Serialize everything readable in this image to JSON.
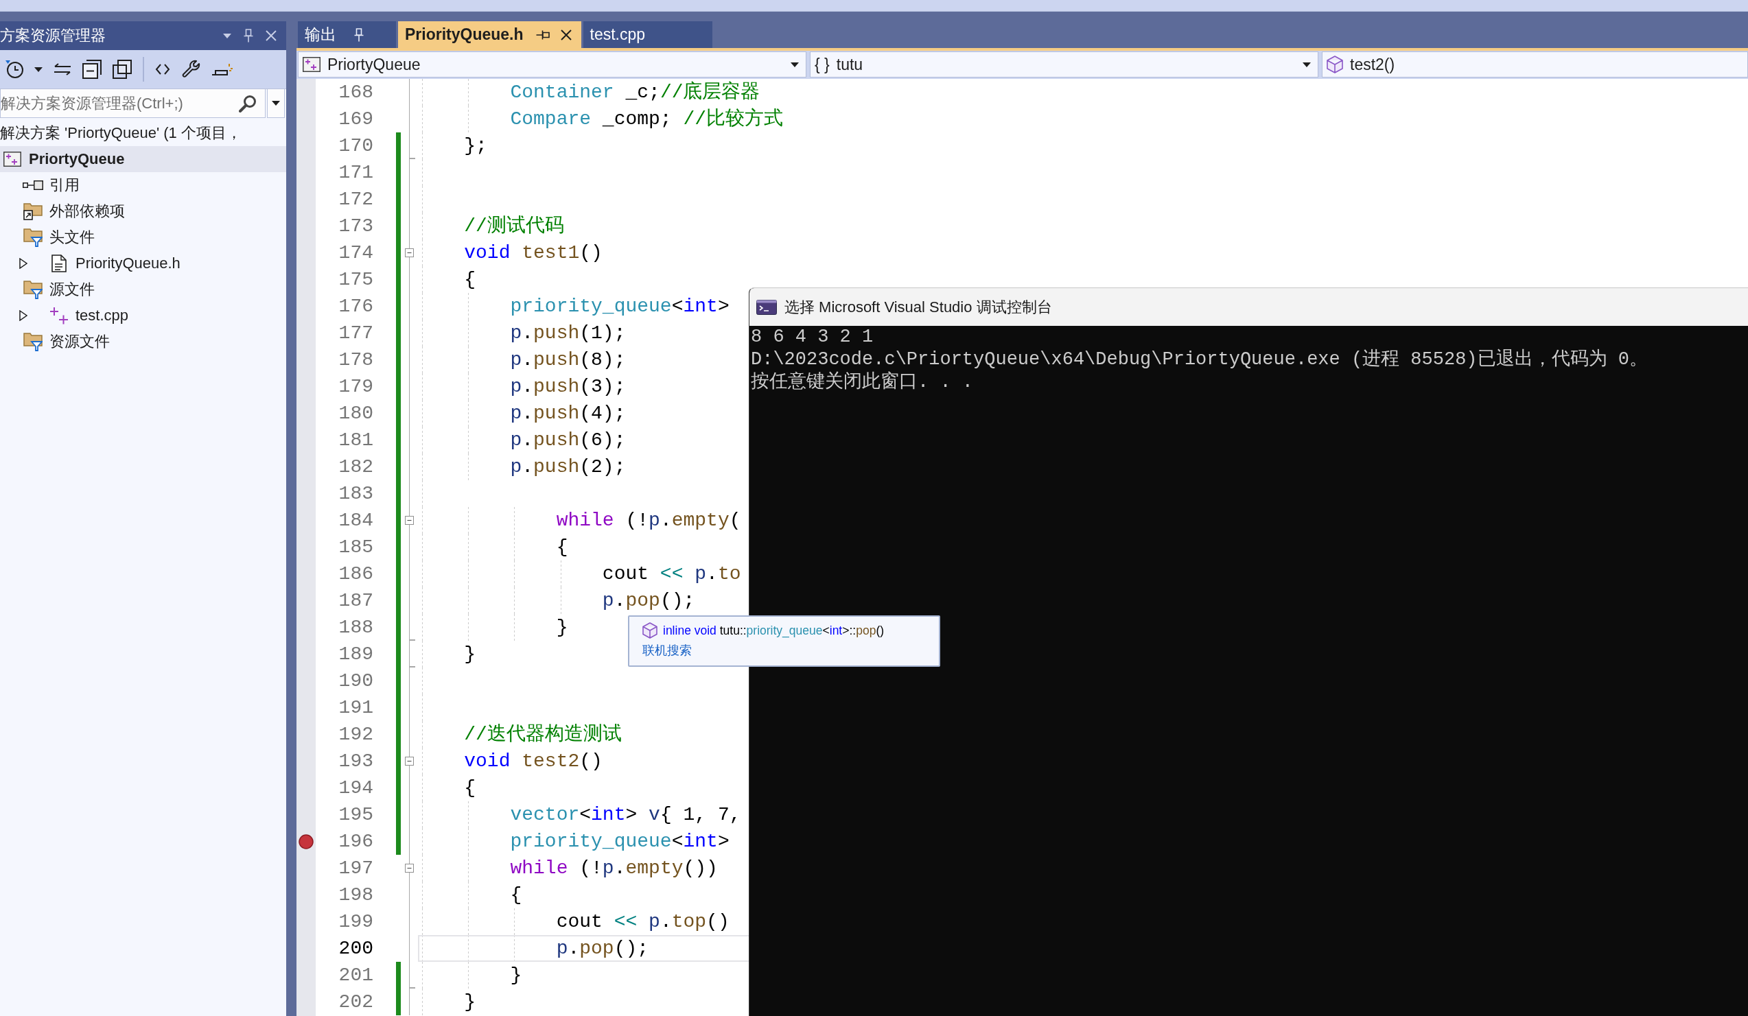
{
  "solution_explorer": {
    "title": "方案资源管理器",
    "search": {
      "placeholder": "解决方案资源管理器(Ctrl+;)"
    },
    "solution": "解决方案 'PriortyQueue' (1 个项目，",
    "tree": [
      {
        "label": "PriortyQueue",
        "kind": "project",
        "selected": true,
        "children": [
          {
            "label": "引用",
            "kind": "references",
            "selected": false
          },
          {
            "label": "外部依赖项",
            "kind": "external",
            "selected": false
          },
          {
            "label": "头文件",
            "kind": "filter",
            "selected": false,
            "children": [
              {
                "label": "PriorityQueue.h",
                "kind": "header",
                "selected": false,
                "expanded": false
              }
            ]
          },
          {
            "label": "源文件",
            "kind": "filter",
            "selected": false,
            "children": [
              {
                "label": "test.cpp",
                "kind": "source",
                "selected": false,
                "expanded": false
              }
            ]
          },
          {
            "label": "资源文件",
            "kind": "filter",
            "selected": false
          }
        ]
      }
    ]
  },
  "editor_tabs": [
    {
      "label": "输出",
      "kind": "tool",
      "selected": false
    },
    {
      "label": "PriorityQueue.h",
      "kind": "document",
      "selected": true
    },
    {
      "label": "test.cpp",
      "kind": "document",
      "selected": false
    }
  ],
  "navigation": [
    {
      "kind": "project",
      "label": "PriortyQueue",
      "caret": true
    },
    {
      "kind": "namespace",
      "glyph": "{ }",
      "label": "tutu",
      "caret": true
    },
    {
      "kind": "member",
      "label": "test2()",
      "caret": false
    }
  ],
  "code": {
    "lines": [
      {
        "number": "168",
        "changed": false,
        "fold_start": false,
        "fold_end": false,
        "breakpoint": false,
        "current": false,
        "tokens": [
          {
            "kind": "type",
            "text": "        Container"
          },
          {
            "kind": "plain",
            "text": " _c;"
          },
          {
            "kind": "comment",
            "text": "//底层容器"
          }
        ]
      },
      {
        "number": "169",
        "changed": false,
        "fold_start": false,
        "fold_end": false,
        "breakpoint": false,
        "current": false,
        "tokens": [
          {
            "kind": "type",
            "text": "        Compare"
          },
          {
            "kind": "plain",
            "text": " _comp; "
          },
          {
            "kind": "comment",
            "text": "//比较方式"
          }
        ]
      },
      {
        "number": "170",
        "changed": true,
        "fold_start": false,
        "fold_end": true,
        "breakpoint": false,
        "current": false,
        "tokens": [
          {
            "kind": "plain",
            "text": "    };"
          }
        ]
      },
      {
        "number": "171",
        "changed": true,
        "fold_start": false,
        "fold_end": false,
        "breakpoint": false,
        "current": false
      },
      {
        "number": "172",
        "changed": true,
        "fold_start": false,
        "fold_end": false,
        "breakpoint": false,
        "current": false
      },
      {
        "number": "173",
        "changed": true,
        "fold_start": false,
        "fold_end": false,
        "breakpoint": false,
        "current": false,
        "tokens": [
          {
            "kind": "comment",
            "text": "    //测试代码"
          }
        ]
      },
      {
        "number": "174",
        "changed": true,
        "fold_start": true,
        "fold_end": false,
        "breakpoint": false,
        "current": false,
        "tokens": [
          {
            "kind": "keyword",
            "text": "    void"
          },
          {
            "kind": "function",
            "text": " test1"
          },
          {
            "kind": "plain",
            "text": "()"
          }
        ]
      },
      {
        "number": "175",
        "changed": true,
        "fold_start": false,
        "fold_end": false,
        "breakpoint": false,
        "current": false,
        "tokens": [
          {
            "kind": "plain",
            "text": "    {"
          }
        ]
      },
      {
        "number": "176",
        "changed": true,
        "fold_start": false,
        "fold_end": false,
        "breakpoint": false,
        "current": false,
        "tokens": [
          {
            "kind": "type",
            "text": "        priority_queue"
          },
          {
            "kind": "plain",
            "text": "<"
          },
          {
            "kind": "keyword",
            "text": "int"
          },
          {
            "kind": "plain",
            "text": ">"
          }
        ]
      },
      {
        "number": "177",
        "changed": true,
        "fold_start": false,
        "fold_end": false,
        "breakpoint": false,
        "current": false,
        "tokens": [
          {
            "kind": "variable",
            "text": "        p"
          },
          {
            "kind": "plain",
            "text": "."
          },
          {
            "kind": "function",
            "text": "push"
          },
          {
            "kind": "plain",
            "text": "(1);"
          }
        ]
      },
      {
        "number": "178",
        "changed": true,
        "fold_start": false,
        "fold_end": false,
        "breakpoint": false,
        "current": false,
        "tokens": [
          {
            "kind": "variable",
            "text": "        p"
          },
          {
            "kind": "plain",
            "text": "."
          },
          {
            "kind": "function",
            "text": "push"
          },
          {
            "kind": "plain",
            "text": "(8);"
          }
        ]
      },
      {
        "number": "179",
        "changed": true,
        "fold_start": false,
        "fold_end": false,
        "breakpoint": false,
        "current": false,
        "tokens": [
          {
            "kind": "variable",
            "text": "        p"
          },
          {
            "kind": "plain",
            "text": "."
          },
          {
            "kind": "function",
            "text": "push"
          },
          {
            "kind": "plain",
            "text": "(3);"
          }
        ]
      },
      {
        "number": "180",
        "changed": true,
        "fold_start": false,
        "fold_end": false,
        "breakpoint": false,
        "current": false,
        "tokens": [
          {
            "kind": "variable",
            "text": "        p"
          },
          {
            "kind": "plain",
            "text": "."
          },
          {
            "kind": "function",
            "text": "push"
          },
          {
            "kind": "plain",
            "text": "(4);"
          }
        ]
      },
      {
        "number": "181",
        "changed": true,
        "fold_start": false,
        "fold_end": false,
        "breakpoint": false,
        "current": false,
        "tokens": [
          {
            "kind": "variable",
            "text": "        p"
          },
          {
            "kind": "plain",
            "text": "."
          },
          {
            "kind": "function",
            "text": "push"
          },
          {
            "kind": "plain",
            "text": "(6);"
          }
        ]
      },
      {
        "number": "182",
        "changed": true,
        "fold_start": false,
        "fold_end": false,
        "breakpoint": false,
        "current": false,
        "tokens": [
          {
            "kind": "variable",
            "text": "        p"
          },
          {
            "kind": "plain",
            "text": "."
          },
          {
            "kind": "function",
            "text": "push"
          },
          {
            "kind": "plain",
            "text": "(2);"
          }
        ]
      },
      {
        "number": "183",
        "changed": true,
        "fold_start": false,
        "fold_end": false,
        "breakpoint": false,
        "current": false
      },
      {
        "number": "184",
        "changed": true,
        "fold_start": true,
        "fold_end": false,
        "breakpoint": false,
        "current": false,
        "tokens": [
          {
            "kind": "control",
            "text": "            while"
          },
          {
            "kind": "plain",
            "text": " (!"
          },
          {
            "kind": "variable",
            "text": "p"
          },
          {
            "kind": "plain",
            "text": "."
          },
          {
            "kind": "function",
            "text": "empty"
          },
          {
            "kind": "plain",
            "text": "("
          }
        ]
      },
      {
        "number": "185",
        "changed": true,
        "fold_start": false,
        "fold_end": false,
        "breakpoint": false,
        "current": false,
        "tokens": [
          {
            "kind": "plain",
            "text": "            {"
          }
        ]
      },
      {
        "number": "186",
        "changed": true,
        "fold_start": false,
        "fold_end": false,
        "breakpoint": false,
        "current": false,
        "tokens": [
          {
            "kind": "plain",
            "text": "                cout "
          },
          {
            "kind": "operator",
            "text": "<<"
          },
          {
            "kind": "variable",
            "text": " p"
          },
          {
            "kind": "plain",
            "text": "."
          },
          {
            "kind": "function",
            "text": "to"
          }
        ]
      },
      {
        "number": "187",
        "changed": true,
        "fold_start": false,
        "fold_end": false,
        "breakpoint": false,
        "current": false,
        "tokens": [
          {
            "kind": "variable",
            "text": "                p"
          },
          {
            "kind": "plain",
            "text": "."
          },
          {
            "kind": "function",
            "text": "pop"
          },
          {
            "kind": "plain",
            "text": "();"
          }
        ]
      },
      {
        "number": "188",
        "changed": true,
        "fold_start": false,
        "fold_end": true,
        "breakpoint": false,
        "current": false,
        "tokens": [
          {
            "kind": "plain",
            "text": "            }"
          }
        ]
      },
      {
        "number": "189",
        "changed": true,
        "fold_start": false,
        "fold_end": true,
        "breakpoint": false,
        "current": false,
        "tokens": [
          {
            "kind": "plain",
            "text": "    }"
          }
        ]
      },
      {
        "number": "190",
        "changed": true,
        "fold_start": false,
        "fold_end": false,
        "breakpoint": false,
        "current": false
      },
      {
        "number": "191",
        "changed": true,
        "fold_start": false,
        "fold_end": false,
        "breakpoint": false,
        "current": false
      },
      {
        "number": "192",
        "changed": true,
        "fold_start": false,
        "fold_end": false,
        "breakpoint": false,
        "current": false,
        "tokens": [
          {
            "kind": "comment",
            "text": "    //迭代器构造测试"
          }
        ]
      },
      {
        "number": "193",
        "changed": true,
        "fold_start": true,
        "fold_end": false,
        "breakpoint": false,
        "current": false,
        "tokens": [
          {
            "kind": "keyword",
            "text": "    void"
          },
          {
            "kind": "function",
            "text": " test2"
          },
          {
            "kind": "plain",
            "text": "()"
          }
        ]
      },
      {
        "number": "194",
        "changed": true,
        "fold_start": false,
        "fold_end": false,
        "breakpoint": false,
        "current": false,
        "tokens": [
          {
            "kind": "plain",
            "text": "    {"
          }
        ]
      },
      {
        "number": "195",
        "changed": true,
        "fold_start": false,
        "fold_end": false,
        "breakpoint": false,
        "current": false,
        "tokens": [
          {
            "kind": "type",
            "text": "        vector"
          },
          {
            "kind": "plain",
            "text": "<"
          },
          {
            "kind": "keyword",
            "text": "int"
          },
          {
            "kind": "plain",
            "text": "> "
          },
          {
            "kind": "variable",
            "text": "v"
          },
          {
            "kind": "plain",
            "text": "{ 1, 7,"
          }
        ]
      },
      {
        "number": "196",
        "changed": true,
        "fold_start": false,
        "fold_end": false,
        "breakpoint": true,
        "current": false,
        "tokens": [
          {
            "kind": "type",
            "text": "        priority_queue"
          },
          {
            "kind": "plain",
            "text": "<"
          },
          {
            "kind": "keyword",
            "text": "int"
          },
          {
            "kind": "plain",
            "text": ">"
          }
        ]
      },
      {
        "number": "197",
        "changed": false,
        "fold_start": true,
        "fold_end": false,
        "breakpoint": false,
        "current": false,
        "tokens": [
          {
            "kind": "control",
            "text": "        while"
          },
          {
            "kind": "plain",
            "text": " (!"
          },
          {
            "kind": "variable",
            "text": "p"
          },
          {
            "kind": "plain",
            "text": "."
          },
          {
            "kind": "function",
            "text": "empty"
          },
          {
            "kind": "plain",
            "text": "())"
          }
        ]
      },
      {
        "number": "198",
        "changed": false,
        "fold_start": false,
        "fold_end": false,
        "breakpoint": false,
        "current": false,
        "tokens": [
          {
            "kind": "plain",
            "text": "        {"
          }
        ]
      },
      {
        "number": "199",
        "changed": false,
        "fold_start": false,
        "fold_end": false,
        "breakpoint": false,
        "current": false,
        "tokens": [
          {
            "kind": "plain",
            "text": "            cout "
          },
          {
            "kind": "operator",
            "text": "<<"
          },
          {
            "kind": "variable",
            "text": " p"
          },
          {
            "kind": "plain",
            "text": "."
          },
          {
            "kind": "function",
            "text": "top"
          },
          {
            "kind": "plain",
            "text": "()"
          }
        ]
      },
      {
        "number": "200",
        "changed": false,
        "fold_start": false,
        "fold_end": false,
        "breakpoint": false,
        "current": true,
        "tokens": [
          {
            "kind": "variable",
            "text": "            p"
          },
          {
            "kind": "plain",
            "text": "."
          },
          {
            "kind": "function",
            "text": "pop"
          },
          {
            "kind": "plain",
            "text": "();"
          }
        ]
      },
      {
        "number": "201",
        "changed": true,
        "fold_start": false,
        "fold_end": true,
        "breakpoint": false,
        "current": false,
        "tokens": [
          {
            "kind": "plain",
            "text": "        }"
          }
        ]
      },
      {
        "number": "202",
        "changed": true,
        "fold_start": false,
        "fold_end": false,
        "breakpoint": false,
        "current": false,
        "tokens": [
          {
            "kind": "plain",
            "text": "    }"
          }
        ]
      }
    ]
  },
  "console": {
    "title": "选择 Microsoft Visual Studio 调试控制台",
    "lines": [
      "8 6 4 3 2 1",
      "D:\\2023code.c\\PriortyQueue\\x64\\Debug\\PriortyQueue.exe (进程 85528)已退出，代码为 0。",
      "按任意键关闭此窗口. . ."
    ]
  },
  "tooltip": {
    "signature": [
      {
        "kind": "keyword",
        "text": "inline void"
      },
      {
        "kind": "plain",
        "text": " tutu::"
      },
      {
        "kind": "type",
        "text": "priority_queue"
      },
      {
        "kind": "plain",
        "text": "<"
      },
      {
        "kind": "keyword",
        "text": "int"
      },
      {
        "kind": "plain",
        "text": ">::"
      },
      {
        "kind": "function",
        "text": "pop"
      },
      {
        "kind": "plain",
        "text": "()"
      }
    ],
    "link": "联机搜索"
  }
}
